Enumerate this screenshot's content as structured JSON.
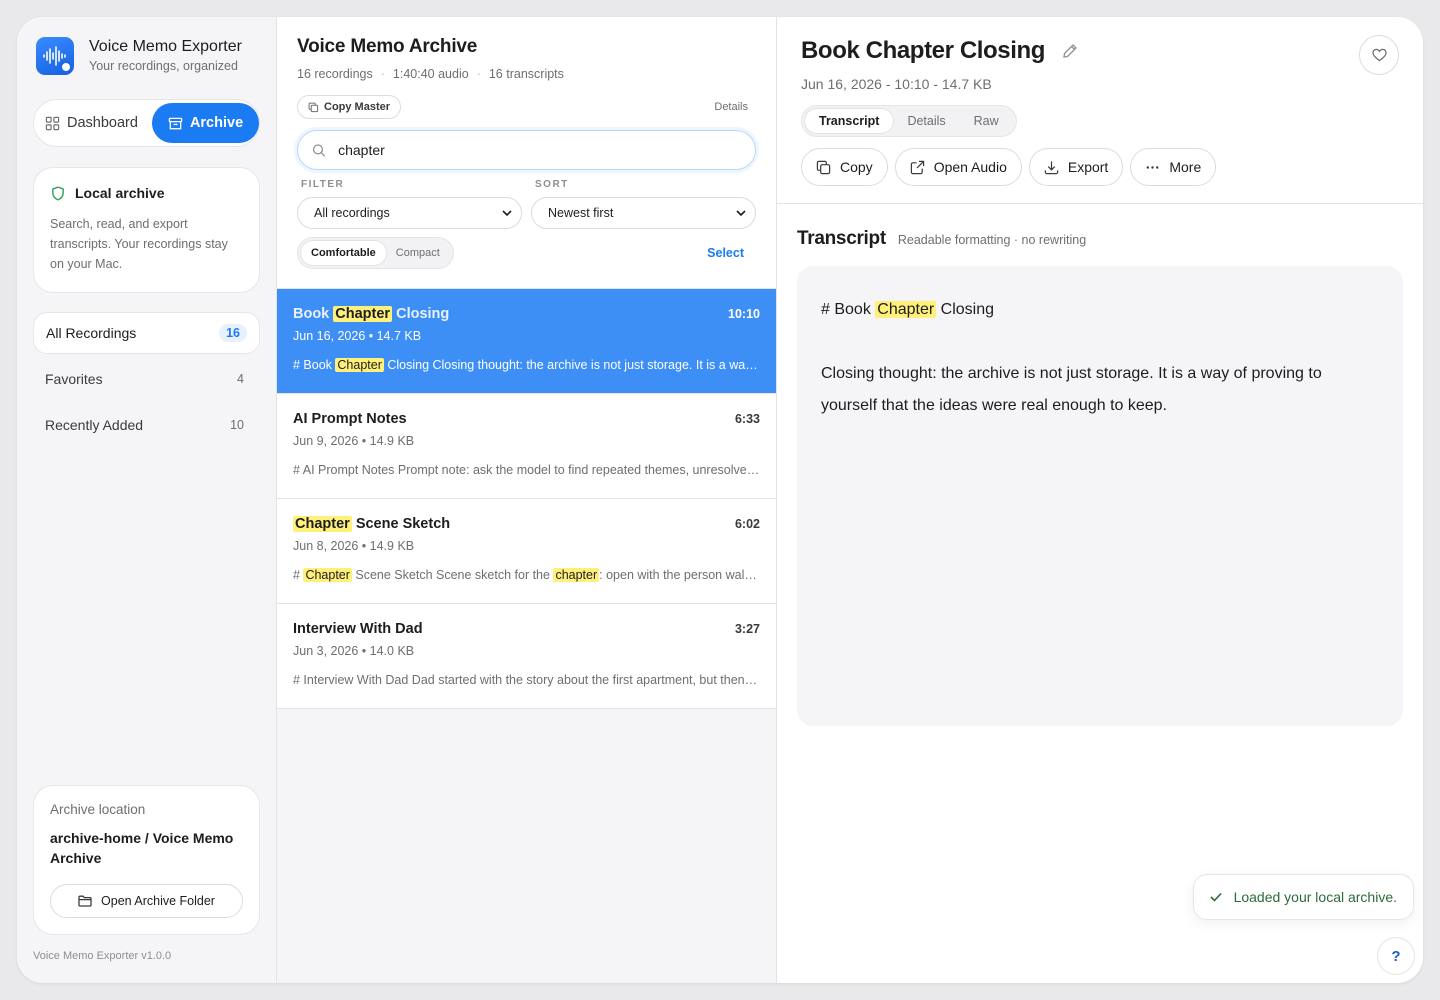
{
  "app": {
    "title": "Voice Memo Exporter",
    "subtitle": "Your recordings, organized",
    "version": "Voice Memo Exporter v1.0.0",
    "accent": "#1a7bf2"
  },
  "nav_segment": {
    "dashboard_label": "Dashboard",
    "archive_label": "Archive",
    "active": "Archive"
  },
  "local_card": {
    "title": "Local archive",
    "description": "Search, read, and export transcripts. Your recordings stay on your Mac."
  },
  "sidebar": {
    "items": [
      {
        "label": "All Recordings",
        "count": "16",
        "active": true
      },
      {
        "label": "Favorites",
        "count": "4",
        "active": false
      },
      {
        "label": "Recently Added",
        "count": "10",
        "active": false
      }
    ]
  },
  "location": {
    "label": "Archive location",
    "path": "archive-home / Voice Memo Archive",
    "button_label": "Open Archive Folder"
  },
  "list": {
    "title": "Voice Memo Archive",
    "stats": [
      "16 recordings",
      "1:40:40 audio",
      "16 transcripts"
    ],
    "copy_master_label": "Copy Master",
    "details_label": "Details",
    "search_value": "chapter",
    "filter_label": "FILTER",
    "filter_value": "All recordings",
    "sort_label": "SORT",
    "sort_value": "Newest first",
    "density_options": [
      "Comfortable",
      "Compact"
    ],
    "density_selected": "Comfortable",
    "select_label": "Select"
  },
  "recordings": [
    {
      "title_parts": [
        "Book ",
        "Chapter",
        " Closing"
      ],
      "duration": "10:10",
      "meta": "Jun 16, 2026 • 14.7 KB",
      "snippet_parts": [
        "# Book ",
        "Chapter",
        " Closing Closing thought: the archive is not just storage. It is a way of proving to yourself that the ideas were real enough to keep."
      ],
      "selected": true
    },
    {
      "title_parts": [
        "AI Prompt Notes"
      ],
      "duration": "6:33",
      "meta": "Jun 9, 2026 • 14.9 KB",
      "snippet_parts": [
        "# AI Prompt Notes Prompt note: ask the model to find repeated themes, unresolved questions and next steps."
      ],
      "selected": false
    },
    {
      "title_parts": [
        "",
        "Chapter",
        " Scene Sketch"
      ],
      "duration": "6:02",
      "meta": "Jun 8, 2026 • 14.9 KB",
      "snippet_parts": [
        "# ",
        "Chapter",
        " Scene Sketch Scene sketch for the ",
        "chapter",
        ": open with the person walking in."
      ],
      "selected": false
    },
    {
      "title_parts": [
        "Interview With Dad"
      ],
      "duration": "3:27",
      "meta": "Jun 3, 2026 • 14.0 KB",
      "snippet_parts": [
        "# Interview With Dad Dad started with the story about the first apartment, but then drifted."
      ],
      "selected": false
    }
  ],
  "detail": {
    "title": "Book Chapter Closing",
    "meta": "Jun 16, 2026 - 10:10 - 14.7 KB",
    "tabs": [
      "Transcript",
      "Details",
      "Raw"
    ],
    "active_tab": "Transcript",
    "actions": [
      "Copy",
      "Open Audio",
      "Export",
      "More"
    ]
  },
  "transcript": {
    "title": "Transcript",
    "subtitle": "Readable formatting · no rewriting",
    "heading_parts": [
      "# Book ",
      "Chapter",
      " Closing"
    ],
    "body": "Closing thought: the archive is not just storage. It is a way of proving to yourself that the ideas were real enough to keep."
  },
  "toast": {
    "message": "Loaded your local archive."
  },
  "help": {
    "label": "?"
  }
}
